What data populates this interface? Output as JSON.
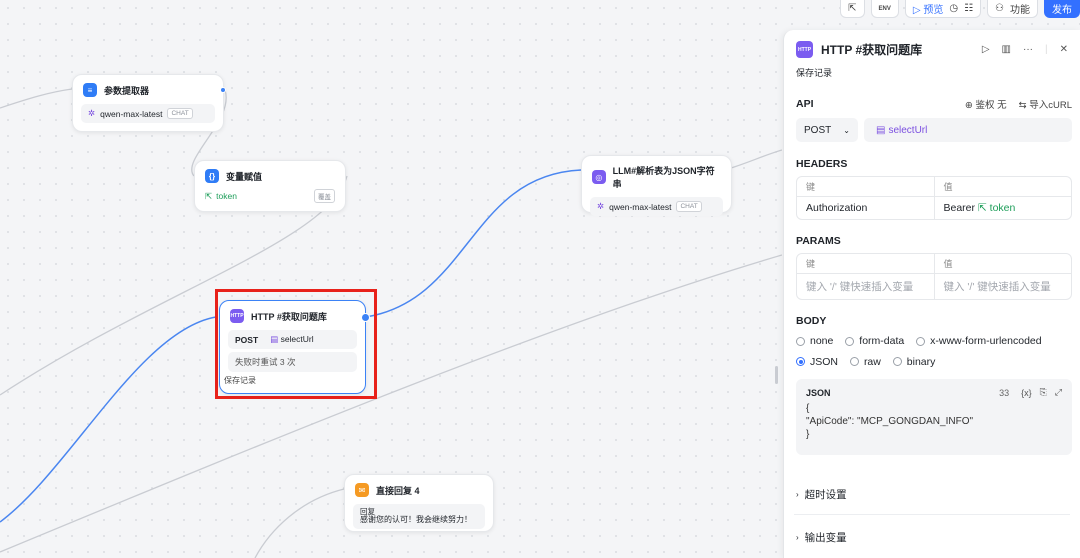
{
  "nodes": {
    "param_extractor": {
      "title": "参数提取器",
      "model": "qwen-max-latest",
      "tag": "CHAT"
    },
    "var_assign": {
      "title": "变量赋值",
      "var": "token",
      "tag": "覆盖"
    },
    "llm": {
      "title": "LLM#解析表为JSON字符串",
      "model": "qwen-max-latest",
      "tag": "CHAT"
    },
    "http": {
      "title": "HTTP #获取问题库",
      "method": "POST",
      "url": "selectUrl",
      "retry": "失败时重试 3 次",
      "save": "保存记录"
    },
    "reply": {
      "title": "直接回复 4",
      "label": "回复",
      "text": "感谢您的认可！我会继续努力！"
    }
  },
  "toolbar": {
    "preview": "预览",
    "functions": "功能",
    "publish": "发布",
    "env": "ENV"
  },
  "panel": {
    "title": "HTTP #获取问题库",
    "subtitle": "保存记录",
    "api": {
      "label": "API",
      "auth": "鉴权 无",
      "import": "导入cURL",
      "method": "POST",
      "url": "selectUrl"
    },
    "headers": {
      "label": "HEADERS",
      "col_key": "键",
      "col_val": "值",
      "rows": [
        {
          "key": "Authorization",
          "val_prefix": "Bearer",
          "val_var": "token"
        }
      ]
    },
    "params": {
      "label": "PARAMS",
      "col_key": "键",
      "col_val": "值",
      "key_placeholder": "键入 '/' 键快速插入变量",
      "val_placeholder": "键入 '/' 键快速插入变量"
    },
    "body": {
      "label": "BODY",
      "options": [
        "none",
        "form-data",
        "x-www-form-urlencoded",
        "JSON",
        "raw",
        "binary"
      ],
      "selected": "JSON",
      "json_label": "JSON",
      "json_count": "33",
      "json_lines": [
        "{",
        "\"ApiCode\": \"MCP_GONGDAN_INFO\"",
        "}"
      ]
    },
    "timeout": "超时设置",
    "output": "输出变量"
  },
  "colors": {
    "accent": "#3370ff",
    "highlight": "#e8221b",
    "edge": "#4a86f0"
  }
}
